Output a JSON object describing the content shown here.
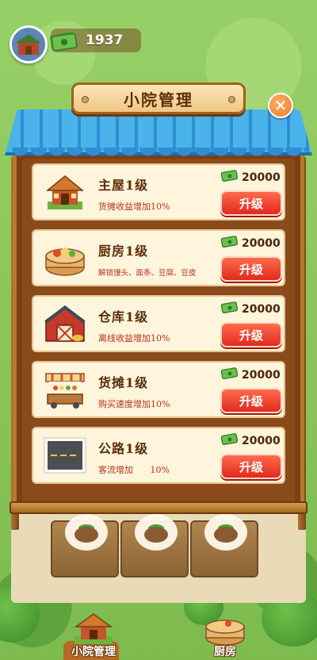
{
  "hud": {
    "coins": "1937"
  },
  "dialog": {
    "title": "小院管理",
    "close_icon": "close-icon"
  },
  "rows": [
    {
      "name": "主屋1级",
      "desc": "货摊收益增加10%",
      "price": "20000",
      "button": "升级",
      "icon": "main-house-icon"
    },
    {
      "name": "厨房1级",
      "desc": "解锁馒头、面条、豆腐、豆皮",
      "price": "20000",
      "button": "升级",
      "icon": "kitchen-steamer-icon"
    },
    {
      "name": "仓库1级",
      "desc": "离线收益增加10%",
      "price": "20000",
      "button": "升级",
      "icon": "warehouse-barn-icon"
    },
    {
      "name": "货摊1级",
      "desc": "购买速度增加10%",
      "price": "20000",
      "button": "升级",
      "icon": "stall-icon"
    },
    {
      "name": "公路1级",
      "desc": "客流增加",
      "desc_pct": "10%",
      "price": "20000",
      "button": "升级",
      "icon": "road-icon"
    }
  ],
  "nav": {
    "yard": "小院管理",
    "kitchen": "厨房"
  },
  "colors": {
    "upgrade": "#e02a1e",
    "panel": "#8a4a1c",
    "row": "#fff4dc",
    "roof": "#4ab4ea"
  }
}
